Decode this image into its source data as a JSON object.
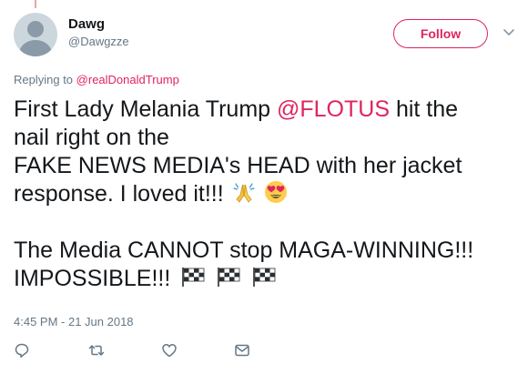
{
  "user": {
    "display_name": "Dawg",
    "handle": "@Dawgzze"
  },
  "follow_button": {
    "label": "Follow"
  },
  "reply": {
    "prefix": "Replying to",
    "mention": "@realDonaldTrump"
  },
  "tweet": {
    "line1_before": "First Lady Melania Trump ",
    "line1_mention": "@FLOTUS",
    "line1_after": " hit the",
    "line2": "nail right on the",
    "line3": "FAKE NEWS MEDIA's HEAD with her jacket",
    "line4": "response. I loved it!!!",
    "line5": "The Media CANNOT stop MAGA-WINNING!!!",
    "line6": "IMPOSSIBLE!!!"
  },
  "timestamp": "4:45 PM - 21 Jun 2018",
  "actions": [
    "reply-icon",
    "retweet-icon",
    "like-icon",
    "message-icon"
  ],
  "colors": {
    "accent": "#e0245e",
    "secondary_text": "#657786",
    "primary_text": "#14171a"
  }
}
